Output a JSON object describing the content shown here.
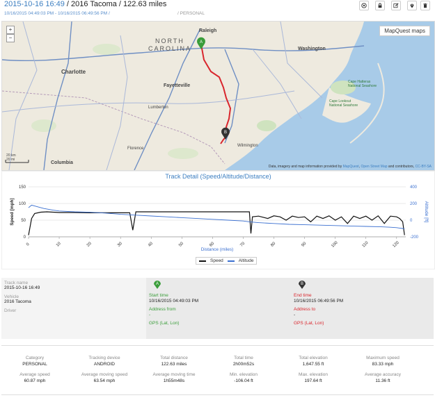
{
  "header": {
    "datetime": "2015-10-16 16:49",
    "rest": " / 2016 Tacoma / 122.63 miles",
    "subrange": "10/16/2015 04:49:03 PM - 10/16/2015 06:49:56 PM /",
    "category": "/ PERSONAL"
  },
  "map": {
    "provider_button": "MapQuest maps",
    "attribution_prefix": "Data, imagery and map information provided by ",
    "attribution_links": [
      "MapQuest",
      "Open Street Map"
    ],
    "attribution_mid": " and contributors, ",
    "attribution_license": "CC-BY-SA",
    "scale_km": "20 km",
    "scale_mi": "20 mi",
    "labels": [
      {
        "text": "Raleigh",
        "id": "raleigh"
      },
      {
        "text": "NORTH",
        "id": "north"
      },
      {
        "text": "CAROLINA",
        "id": "carolina"
      },
      {
        "text": "Charlotte",
        "id": "charlotte"
      },
      {
        "text": "Fayetteville",
        "id": "fayetteville"
      },
      {
        "text": "Washington",
        "id": "washington"
      },
      {
        "text": "Wilmington",
        "id": "wilmington"
      },
      {
        "text": "Columbia",
        "id": "columbia"
      },
      {
        "text": "Florence",
        "id": "florence"
      },
      {
        "text": "Lumberton",
        "id": "lumberton"
      },
      {
        "text": "Cape Hatteras National Seashore",
        "id": "hatteras"
      },
      {
        "text": "Cape Lookout National Seashore",
        "id": "lookout"
      }
    ],
    "route_color": "#d9262d",
    "start_marker": "A",
    "end_marker": "B"
  },
  "chart_data": {
    "type": "line",
    "title": "Track Detail (Speed/Altitude/Distance)",
    "xlabel": "Distance (miles)",
    "ylabel_left": "Speed [mph]",
    "ylabel_right": "Altitude [ft]",
    "xlim": [
      0,
      123
    ],
    "ylim_left": [
      0,
      150
    ],
    "ylim_right": [
      -200,
      400
    ],
    "xticks": [
      0,
      10,
      20,
      30,
      40,
      50,
      60,
      70,
      80,
      90,
      100,
      110,
      120
    ],
    "yticks_left": [
      0,
      50,
      100,
      150
    ],
    "yticks_right": [
      -200,
      0,
      200,
      400
    ],
    "series": [
      {
        "name": "Speed",
        "color": "#111111",
        "axis": "left",
        "x": [
          0,
          1,
          2,
          4,
          6,
          8,
          10,
          15,
          20,
          25,
          30,
          33,
          34,
          35,
          40,
          45,
          50,
          55,
          60,
          65,
          70,
          72,
          72.5,
          73,
          75,
          78,
          80,
          82,
          84,
          86,
          88,
          90,
          92,
          94,
          96,
          98,
          100,
          102,
          104,
          106,
          108,
          110,
          112,
          114,
          116,
          118,
          120,
          121,
          122,
          122.6
        ],
        "y": [
          5,
          55,
          70,
          74,
          75,
          74,
          73,
          73,
          72,
          72,
          72,
          72,
          20,
          75,
          75,
          75,
          75,
          75,
          75,
          75,
          75,
          75,
          10,
          60,
          62,
          55,
          63,
          60,
          50,
          62,
          58,
          60,
          45,
          62,
          55,
          63,
          50,
          60,
          40,
          62,
          55,
          62,
          50,
          63,
          40,
          62,
          60,
          55,
          45,
          5
        ]
      },
      {
        "name": "Altitude",
        "color": "#3a6fd0",
        "axis": "right",
        "x": [
          0,
          1,
          2,
          3,
          5,
          8,
          10,
          15,
          20,
          25,
          30,
          35,
          40,
          45,
          50,
          55,
          60,
          65,
          70,
          72,
          75,
          80,
          85,
          90,
          95,
          100,
          105,
          110,
          115,
          118,
          120,
          121,
          122,
          122.6
        ],
        "y": [
          150,
          180,
          170,
          160,
          140,
          120,
          110,
          100,
          95,
          85,
          70,
          60,
          50,
          40,
          30,
          20,
          10,
          0,
          -10,
          -20,
          -30,
          -40,
          -50,
          -55,
          -60,
          -65,
          -70,
          -75,
          -80,
          -85,
          -90,
          -95,
          -100,
          -106
        ]
      }
    ],
    "legend_position": "bottom-center"
  },
  "info": {
    "track_name_label": "Track name",
    "track_name": "2015-10-16 16:49",
    "vehicle_label": "Vehicle",
    "vehicle": "2016 Tacoma",
    "driver_label": "Driver",
    "start_time_label": "Start time",
    "start_time": "10/16/2015 04:49:03 PM",
    "address_from_label": "Address from",
    "address_from": "-",
    "gps_label": "GPS (Lat, Lon)",
    "end_time_label": "End time",
    "end_time": "10/16/2015 06:49:56 PM",
    "address_to_label": "Address to",
    "address_to": "-",
    "gps_label_end": "GPS (Lat, Lon)",
    "start_color": "#3a9d3a",
    "end_color": "#d9262d"
  },
  "stats": {
    "row1": [
      {
        "label": "Category",
        "value": "PERSONAL"
      },
      {
        "label": "Tracking device",
        "value": "ANDROID"
      },
      {
        "label": "Total distance",
        "value": "122.63 miles"
      },
      {
        "label": "Total time",
        "value": "2h00m52s"
      },
      {
        "label": "Total elevation",
        "value": "1,647.55 ft"
      },
      {
        "label": "Maximum speed",
        "value": "83.33 mph"
      }
    ],
    "row2": [
      {
        "label": "Average speed",
        "value": "60.87 mph"
      },
      {
        "label": "Average moving speed",
        "value": "63.54 mph"
      },
      {
        "label": "Average moving time",
        "value": "1h55m48s"
      },
      {
        "label": "Min. elevation",
        "value": "-106.04 ft"
      },
      {
        "label": "Max. elevation",
        "value": "197.64 ft"
      },
      {
        "label": "Average accuracy",
        "value": "11.36 ft"
      }
    ]
  }
}
